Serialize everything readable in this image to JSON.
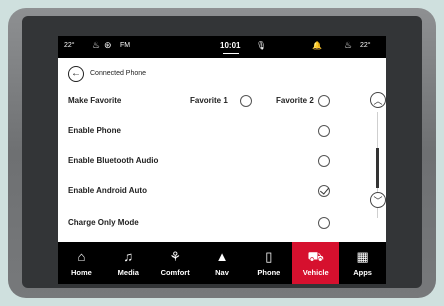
{
  "status": {
    "temp_left": "22°",
    "radio_band": "FM",
    "time": "10:01",
    "temp_right": "22°"
  },
  "header": {
    "back_icon": "back-arrow-icon",
    "title": "Connected Phone"
  },
  "settings": [
    {
      "label": "Make Favorite"
    },
    {
      "label": "Enable Phone",
      "checked": false
    },
    {
      "label": "Enable Bluetooth Audio",
      "checked": false
    },
    {
      "label": "Enable Android Auto",
      "checked": true
    },
    {
      "label": "Charge Only Mode",
      "checked": false
    }
  ],
  "favorites": {
    "favorite1_label": "Favorite 1",
    "favorite2_label": "Favorite 2"
  },
  "nav": [
    {
      "label": "Home",
      "icon": "home-icon"
    },
    {
      "label": "Media",
      "icon": "music-note-icon"
    },
    {
      "label": "Comfort",
      "icon": "seat-fan-icon"
    },
    {
      "label": "Nav",
      "icon": "navigation-arrow-icon"
    },
    {
      "label": "Phone",
      "icon": "phone-icon"
    },
    {
      "label": "Vehicle",
      "icon": "car-icon",
      "active": true
    },
    {
      "label": "Apps",
      "icon": "grid-icon"
    }
  ],
  "colors": {
    "active_tab": "#d6102e",
    "bar_background": "#000000",
    "screen_background": "#ffffff"
  }
}
